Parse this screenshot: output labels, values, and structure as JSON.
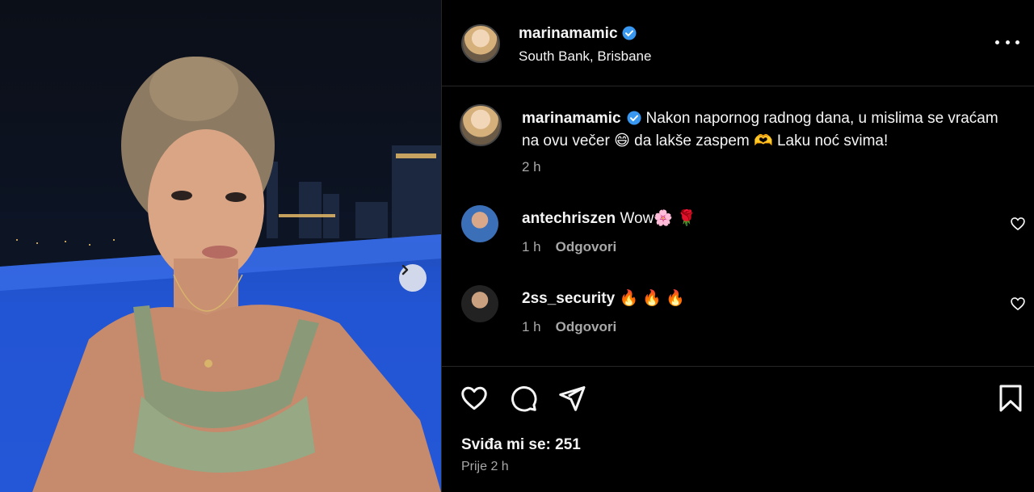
{
  "post": {
    "username": "marinamamic",
    "location": "South Bank, Brisbane",
    "caption_prefix": "Nakon napornog radnog dana, u mislima se vraćam na ovu večer",
    "caption_mid": " da lakše zaspem ",
    "caption_suffix": " Laku noć svima!",
    "emoji_1": "😄",
    "emoji_2": "🫶",
    "caption_time": "2 h",
    "likes_label": "Sviđa mi se: 251",
    "posted_ago": "Prije 2 h"
  },
  "comments": [
    {
      "username": "antechriszen",
      "text": "Wow🌸 🌹",
      "time": "1 h",
      "reply_label": "Odgovori"
    },
    {
      "username": "2ss_security",
      "text": "🔥 🔥 🔥",
      "time": "1 h",
      "reply_label": "Odgovori"
    }
  ],
  "icons": {
    "verified_color": "#3897f0",
    "like": "heart-icon",
    "comment": "comment-icon",
    "share": "share-icon",
    "save": "bookmark-icon",
    "more": "more-icon",
    "next": "chevron-right-icon"
  }
}
